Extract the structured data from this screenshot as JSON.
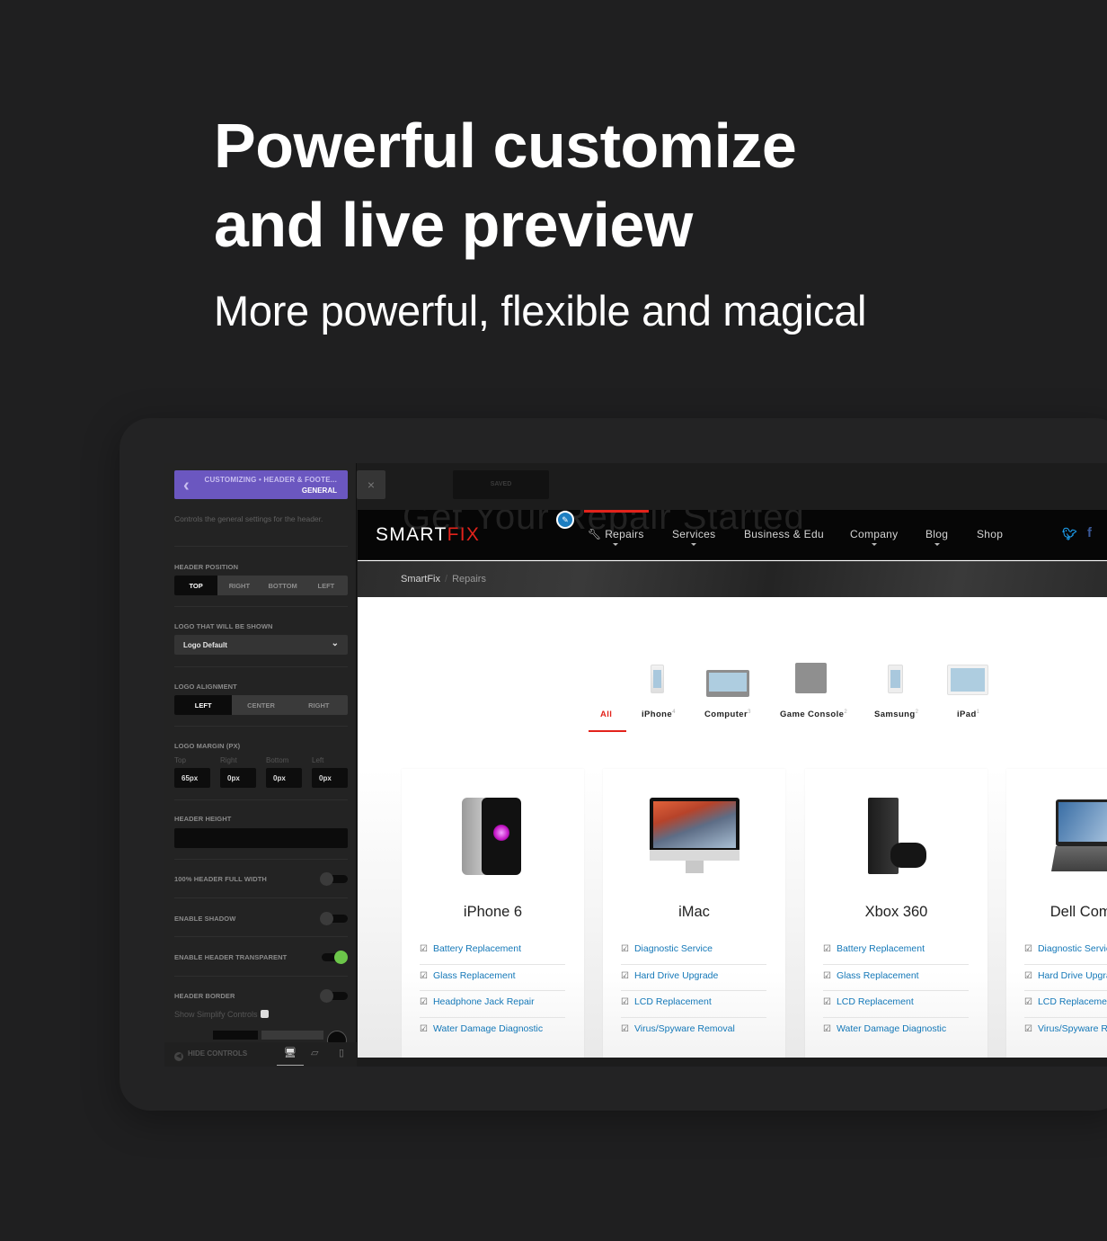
{
  "hero": {
    "title_line1": "Powerful customize",
    "title_line2": "and live preview",
    "subtitle": "More powerful, flexible and magical"
  },
  "customizer": {
    "breadcrumb_top": "CUSTOMIZING • HEADER & FOOTE...",
    "breadcrumb_section": "GENERAL",
    "close_icon": "×",
    "save_label": "SAVED",
    "description": "Controls the general settings for the header.",
    "header_position": {
      "label": "HEADER POSITION",
      "options": [
        "TOP",
        "RIGHT",
        "BOTTOM",
        "LEFT"
      ],
      "selected": "TOP"
    },
    "logo_shown": {
      "label": "LOGO THAT WILL BE SHOWN",
      "value": "Logo Default"
    },
    "logo_alignment": {
      "label": "LOGO ALIGNMENT",
      "options": [
        "LEFT",
        "CENTER",
        "RIGHT"
      ],
      "selected": "LEFT"
    },
    "logo_margin": {
      "label": "LOGO MARGIN (PX)",
      "fields": [
        {
          "label": "Top",
          "value": "65px"
        },
        {
          "label": "Right",
          "value": "0px"
        },
        {
          "label": "Bottom",
          "value": "0px"
        },
        {
          "label": "Left",
          "value": "0px"
        }
      ]
    },
    "header_height": {
      "label": "HEADER HEIGHT",
      "value": ""
    },
    "toggles": [
      {
        "label": "100% HEADER FULL WIDTH",
        "on": false
      },
      {
        "label": "ENABLE SHADOW",
        "on": false
      },
      {
        "label": "ENABLE HEADER TRANSPARENT",
        "on": true
      },
      {
        "label": "HEADER BORDER",
        "on": false
      }
    ],
    "simplify_label": "Show Simplify Controls",
    "hide_controls": "HIDE CONTROLS",
    "devices": [
      "desktop",
      "tablet",
      "mobile"
    ],
    "active_device": "desktop"
  },
  "preview": {
    "ghost_title": "Get Your Repair Started",
    "logo_main": "SMART",
    "logo_accent": "FIX",
    "nav": [
      {
        "label": "Repairs",
        "dropdown": true,
        "icon": "wrench-icon"
      },
      {
        "label": "Services",
        "dropdown": true
      },
      {
        "label": "Business & Edu",
        "dropdown": false
      },
      {
        "label": "Company",
        "dropdown": true
      },
      {
        "label": "Blog",
        "dropdown": true
      },
      {
        "label": "Shop",
        "dropdown": false
      }
    ],
    "social": [
      "twitter-icon",
      "facebook-icon"
    ],
    "breadcrumb": [
      "SmartFix",
      "Repairs"
    ],
    "categories": [
      {
        "label": "All",
        "count": ""
      },
      {
        "label": "iPhone",
        "count": "4"
      },
      {
        "label": "Computer",
        "count": "3"
      },
      {
        "label": "Game Console",
        "count": "2"
      },
      {
        "label": "Samsung",
        "count": "2"
      },
      {
        "label": "iPad",
        "count": "1"
      }
    ],
    "active_category": "All",
    "cards": [
      {
        "title": "iPhone 6",
        "services": [
          "Battery Replacement",
          "Glass Replacement",
          "Headphone Jack Repair",
          "Water Damage Diagnostic"
        ]
      },
      {
        "title": "iMac",
        "services": [
          "Diagnostic Service",
          "Hard Drive Upgrade",
          "LCD Replacement",
          "Virus/Spyware Removal"
        ]
      },
      {
        "title": "Xbox 360",
        "services": [
          "Battery Replacement",
          "Glass Replacement",
          "LCD Replacement",
          "Water Damage Diagnostic"
        ]
      },
      {
        "title": "Dell Computer",
        "services": [
          "Diagnostic Service",
          "Hard Drive Upgrade",
          "LCD Replacement",
          "Virus/Spyware Removal"
        ]
      }
    ]
  },
  "colors": {
    "accent_purple": "#6b57c0",
    "brand_red": "#e3231b",
    "link_blue": "#1478b8",
    "toggle_green": "#6cc64a"
  }
}
